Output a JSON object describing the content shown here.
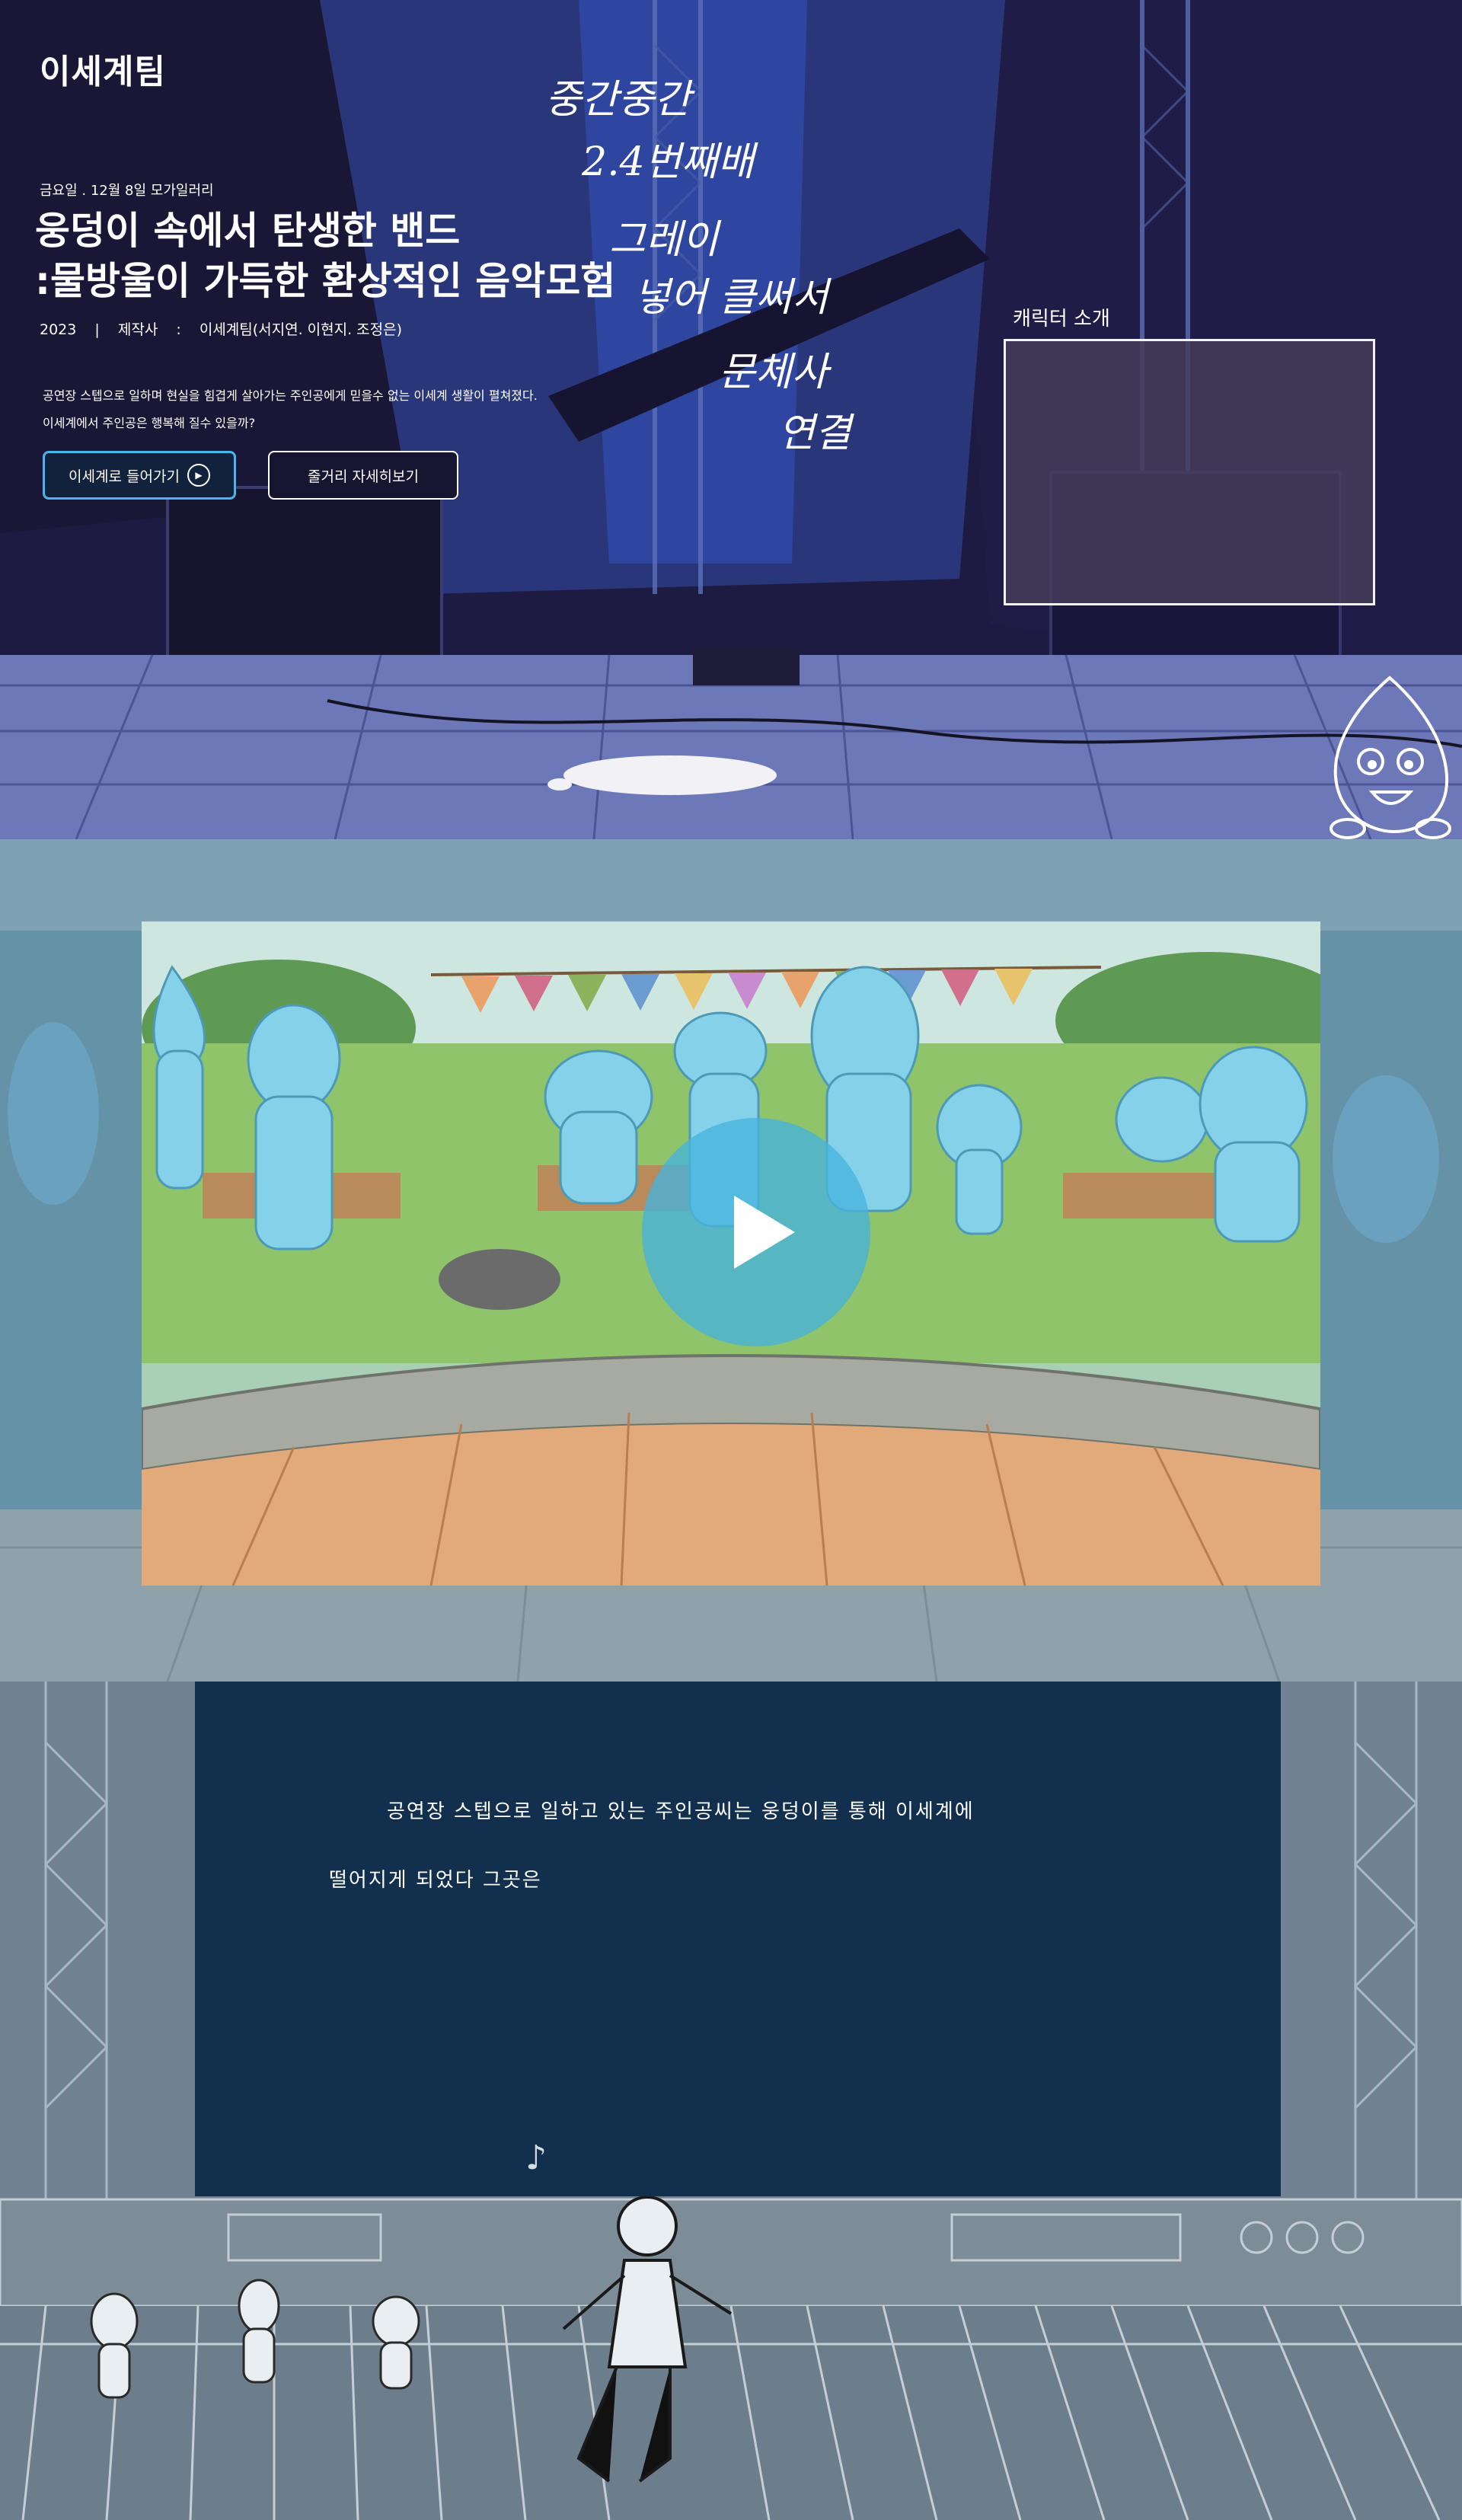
{
  "brand": {
    "logo_text": "이세계팀"
  },
  "hero": {
    "date": "금요일 . 12월 8일 모가일러리",
    "title": "웅덩이 속에서 탄생한 밴드\n:물방울이 가득한 환상적인 음악모험",
    "credits": {
      "year": "2023",
      "separator": "|",
      "producer_label": "제작사",
      "colon": ":",
      "producer": "이세계팀(서지연. 이현지. 조정은)"
    },
    "synopsis": "공연장 스텝으로 일하며 현실을 힘겹게 살아가는 주인공에게 믿을수 없는 이세계 생활이 펼쳐졌다.\n이세계에서 주인공은 행복해 질수 있을까?",
    "buttons": {
      "enter_label": "이세계로 들어가기",
      "story_label": "줄거리 자세히보기"
    },
    "annotations": {
      "line1": "중간중간",
      "line2": "2.4번째배",
      "line3": "그레이",
      "line4": "넣어 클써서",
      "line5": "문체사",
      "line6": "연결"
    },
    "character": {
      "label": "캐릭터 소개"
    }
  },
  "video": {
    "play_label": "play"
  },
  "story": {
    "line1": "공연장 스텝으로 일하고 있는 주인공씨는 웅덩이를 통해 이세계에",
    "line2": "떨어지게 되었다 그곳은"
  },
  "colors": {
    "hero_bg": "#1d1a3f",
    "accent_blue": "#4ab4ef",
    "story_panel": "#12304e",
    "video_bg": "#7fa3b5",
    "play_button": "#46b4dc"
  },
  "icons": {
    "play_small": "play-circle-icon",
    "play_large": "play-icon",
    "note": "music-note-icon"
  }
}
